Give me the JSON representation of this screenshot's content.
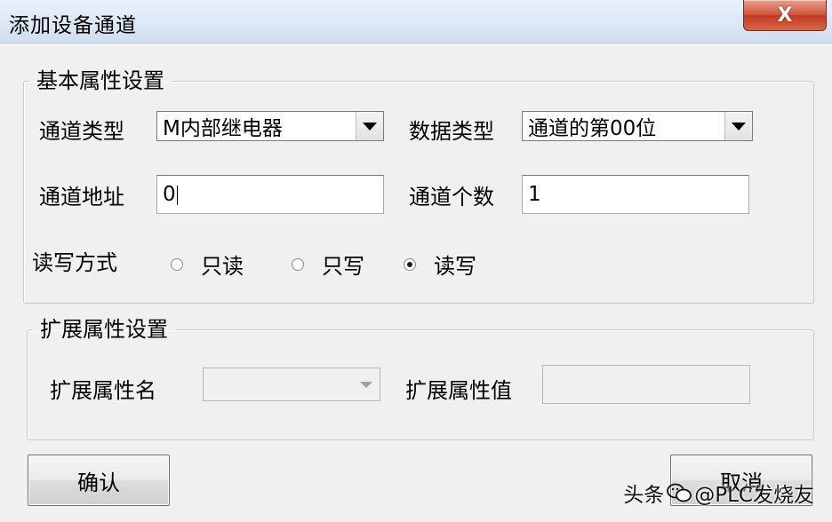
{
  "window": {
    "title": "添加设备通道",
    "close_symbol": "X"
  },
  "basic_group": {
    "legend": "基本属性设置",
    "channel_type": {
      "label": "通道类型",
      "value": "M内部继电器"
    },
    "data_type": {
      "label": "数据类型",
      "value": "通道的第00位"
    },
    "channel_address": {
      "label": "通道地址",
      "value": "0"
    },
    "channel_count": {
      "label": "通道个数",
      "value": "1"
    },
    "rw_mode": {
      "label": "读写方式",
      "options": [
        {
          "label": "只读",
          "checked": false
        },
        {
          "label": "只写",
          "checked": false
        },
        {
          "label": "读写",
          "checked": true
        }
      ]
    }
  },
  "ext_group": {
    "legend": "扩展属性设置",
    "attr_name": {
      "label": "扩展属性名",
      "value": ""
    },
    "attr_value": {
      "label": "扩展属性值",
      "value": ""
    }
  },
  "buttons": {
    "confirm": "确认",
    "cancel": "取消"
  },
  "watermark": {
    "text_prefix": "头条",
    "text_handle": "@PLC发烧友"
  }
}
